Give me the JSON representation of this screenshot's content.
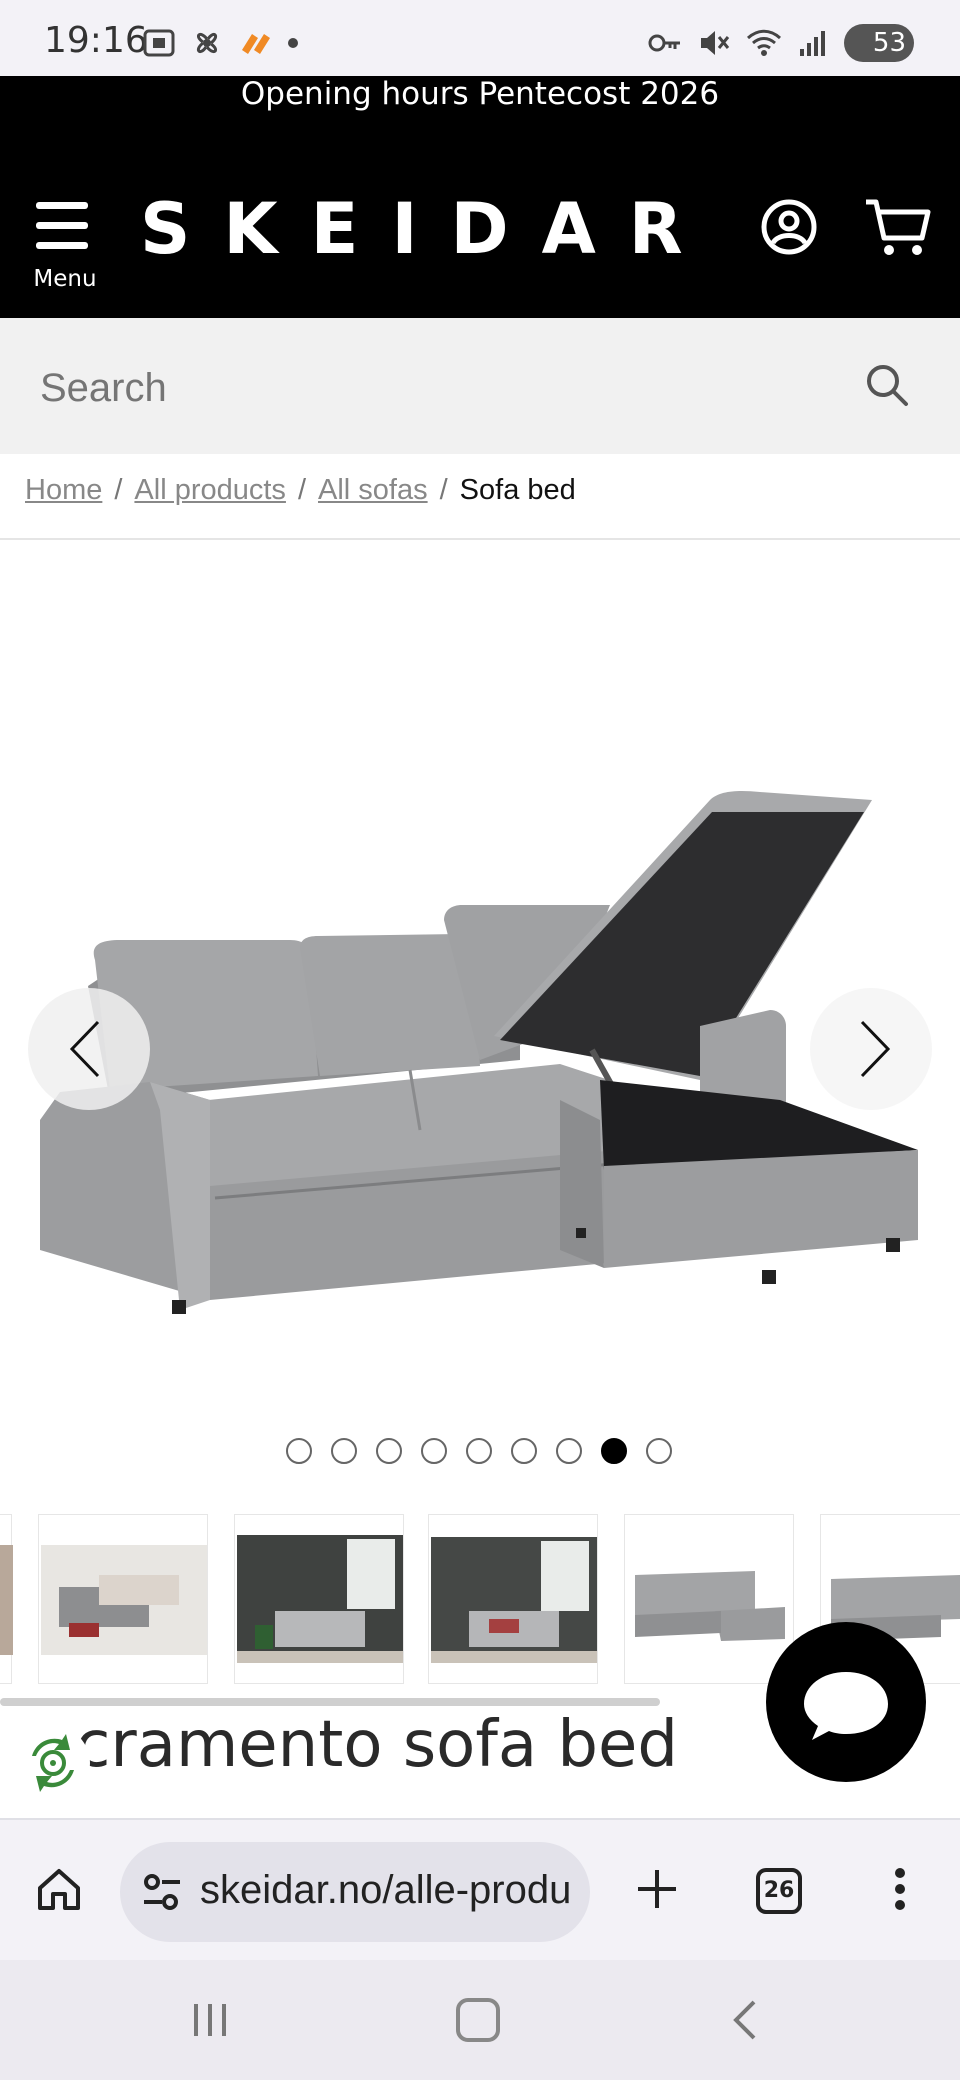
{
  "status_bar": {
    "time": "19:16",
    "battery": "53"
  },
  "header": {
    "promo_text": "Opening hours Pentecost 2026",
    "menu_label": "Menu",
    "logo_text": "SKEIDAR"
  },
  "search": {
    "placeholder": "Search"
  },
  "breadcrumb": {
    "items": [
      "Home",
      "All products",
      "All sofas"
    ],
    "separator": "/",
    "current": "Sofa bed"
  },
  "gallery": {
    "dot_count": 9,
    "active_dot": 8,
    "thumbnails": [
      "partial",
      "sofa-living-room",
      "sofa-dark-room-1",
      "sofa-dark-room-2",
      "sofa-grey-chaise",
      "sofa-grey-partial"
    ]
  },
  "product": {
    "title_visible": "acramento sofa bed"
  },
  "browser": {
    "url": "skeidar.no/alle-produ",
    "tab_count": "26"
  },
  "colors": {
    "header_bg": "#000000",
    "search_bg": "#f1f1f1",
    "sofa_grey": "#9a9a9c",
    "eco_green": "#3a8a3a"
  },
  "icons": {
    "menu": "hamburger-icon",
    "account": "user-circle-icon",
    "cart": "cart-icon",
    "search": "magnifier-icon",
    "chat": "chat-bubble-icon"
  }
}
